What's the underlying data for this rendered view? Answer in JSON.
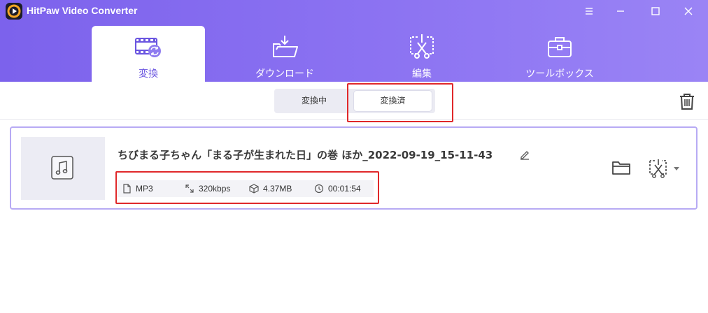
{
  "app": {
    "title": "HitPaw Video Converter"
  },
  "nav": {
    "tabs": [
      {
        "label": "変換",
        "icon": "convert-icon",
        "active": true
      },
      {
        "label": "ダウンロード",
        "icon": "download-icon",
        "active": false
      },
      {
        "label": "編集",
        "icon": "edit-cut-icon",
        "active": false
      },
      {
        "label": "ツールボックス",
        "icon": "toolbox-icon",
        "active": false
      }
    ]
  },
  "subtabs": {
    "converting": "変換中",
    "converted": "変換済"
  },
  "file": {
    "name": "ちびまる子ちゃん「まる子が生まれた日」の巻 ほか_2022-09-19_15-11-43",
    "format": "MP3",
    "bitrate": "320kbps",
    "size": "4.37MB",
    "duration": "00:01:54"
  },
  "colors": {
    "accent": "#7c62ec",
    "highlight": "#e0282a",
    "card_border": "#b7aaf4"
  }
}
